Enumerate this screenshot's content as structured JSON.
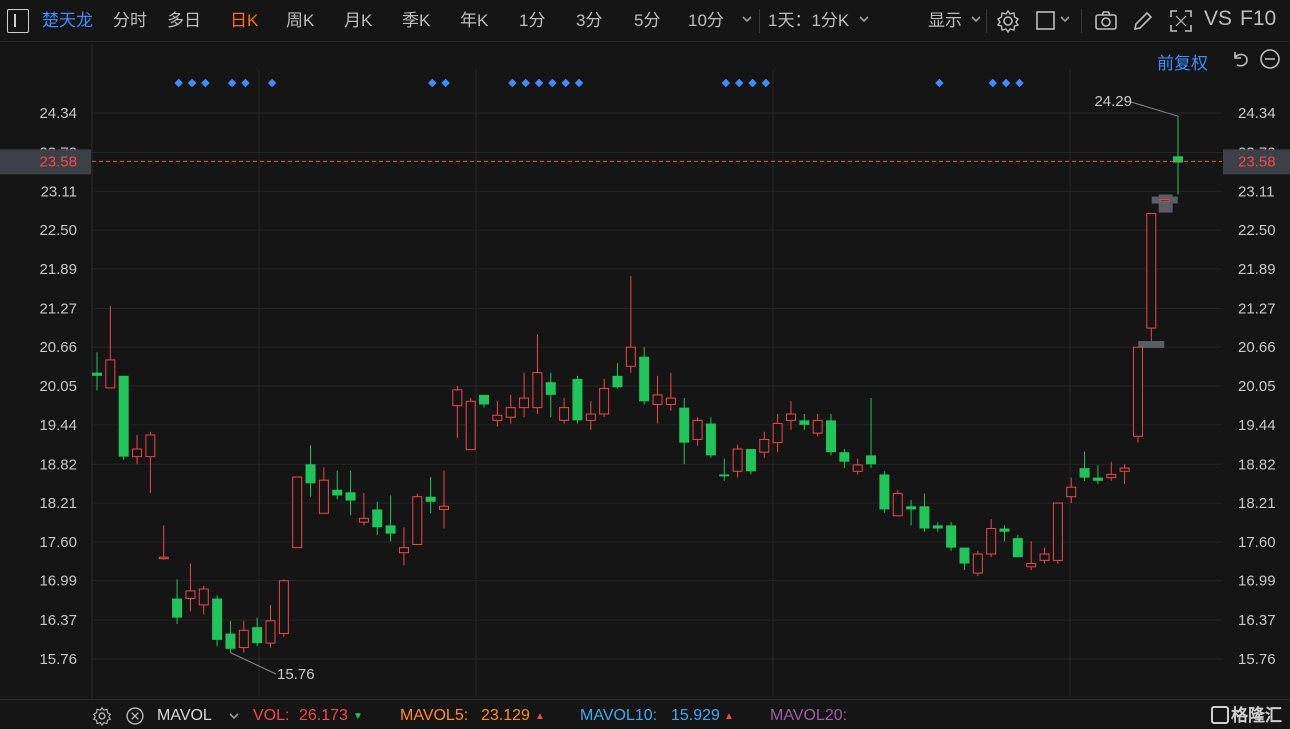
{
  "toolbar": {
    "stock_name": "楚天龙",
    "tabs": [
      "分时",
      "多日",
      "日K",
      "周K",
      "月K",
      "季K",
      "年K",
      "1分",
      "3分",
      "5分",
      "10分"
    ],
    "active_tab": "日K",
    "period_select": "1天：1分K",
    "display_select": "显示",
    "vs_label": "VS",
    "f10_label": "F10"
  },
  "chart_header": {
    "adjust_label": "前复权"
  },
  "chart_data": {
    "type": "candlestick",
    "y_ticks": [
      "24.34",
      "23.72",
      "23.11",
      "22.50",
      "21.89",
      "21.27",
      "20.66",
      "20.05",
      "19.44",
      "18.82",
      "18.21",
      "17.60",
      "16.99",
      "16.37",
      "15.76"
    ],
    "ylim": [
      15.76,
      24.34
    ],
    "current_price": "23.58",
    "max_label": "24.29",
    "min_label": "15.76",
    "up_color": "#f04848",
    "down_color": "#22c35a",
    "candles": [
      {
        "o": 20.26,
        "h": 20.58,
        "l": 19.98,
        "c": 20.21
      },
      {
        "o": 20.02,
        "h": 21.31,
        "l": 20.02,
        "c": 20.46
      },
      {
        "o": 20.21,
        "h": 20.21,
        "l": 18.89,
        "c": 18.94
      },
      {
        "o": 18.94,
        "h": 19.28,
        "l": 18.82,
        "c": 19.06
      },
      {
        "o": 18.94,
        "h": 19.33,
        "l": 18.37,
        "c": 19.28
      },
      {
        "o": 17.36,
        "h": 17.86,
        "l": 17.32,
        "c": 17.36
      },
      {
        "o": 16.71,
        "h": 17.01,
        "l": 16.31,
        "c": 16.41
      },
      {
        "o": 16.71,
        "h": 17.26,
        "l": 16.51,
        "c": 16.83
      },
      {
        "o": 16.61,
        "h": 16.91,
        "l": 16.46,
        "c": 16.86
      },
      {
        "o": 16.71,
        "h": 16.76,
        "l": 15.96,
        "c": 16.06
      },
      {
        "o": 16.16,
        "h": 16.36,
        "l": 15.86,
        "c": 15.92
      },
      {
        "o": 15.94,
        "h": 16.36,
        "l": 15.86,
        "c": 16.21
      },
      {
        "o": 16.26,
        "h": 16.41,
        "l": 15.96,
        "c": 16.01
      },
      {
        "o": 16.01,
        "h": 16.61,
        "l": 15.94,
        "c": 16.36
      },
      {
        "o": 16.16,
        "h": 17.01,
        "l": 16.11,
        "c": 16.99
      },
      {
        "o": 17.51,
        "h": 18.62,
        "l": 17.51,
        "c": 18.62
      },
      {
        "o": 18.82,
        "h": 19.12,
        "l": 18.31,
        "c": 18.52
      },
      {
        "o": 18.05,
        "h": 18.77,
        "l": 18.05,
        "c": 18.57
      },
      {
        "o": 18.42,
        "h": 18.72,
        "l": 18.27,
        "c": 18.33
      },
      {
        "o": 18.38,
        "h": 18.72,
        "l": 18.02,
        "c": 18.25
      },
      {
        "o": 17.91,
        "h": 18.37,
        "l": 17.86,
        "c": 17.97
      },
      {
        "o": 18.11,
        "h": 18.23,
        "l": 17.71,
        "c": 17.83
      },
      {
        "o": 17.86,
        "h": 18.33,
        "l": 17.61,
        "c": 17.73
      },
      {
        "o": 17.43,
        "h": 17.83,
        "l": 17.23,
        "c": 17.51
      },
      {
        "o": 17.56,
        "h": 18.36,
        "l": 17.56,
        "c": 18.31
      },
      {
        "o": 18.31,
        "h": 18.62,
        "l": 18.05,
        "c": 18.23
      },
      {
        "o": 18.11,
        "h": 18.72,
        "l": 17.81,
        "c": 18.16
      },
      {
        "o": 19.74,
        "h": 20.05,
        "l": 19.23,
        "c": 19.99
      },
      {
        "o": 19.05,
        "h": 19.86,
        "l": 19.05,
        "c": 19.81
      },
      {
        "o": 19.91,
        "h": 19.91,
        "l": 19.71,
        "c": 19.76
      },
      {
        "o": 19.51,
        "h": 19.81,
        "l": 19.41,
        "c": 19.59
      },
      {
        "o": 19.56,
        "h": 19.91,
        "l": 19.46,
        "c": 19.71
      },
      {
        "o": 19.71,
        "h": 20.26,
        "l": 19.56,
        "c": 19.86
      },
      {
        "o": 19.71,
        "h": 20.86,
        "l": 19.61,
        "c": 20.26
      },
      {
        "o": 20.11,
        "h": 20.26,
        "l": 19.56,
        "c": 19.91
      },
      {
        "o": 19.51,
        "h": 19.86,
        "l": 19.46,
        "c": 19.71
      },
      {
        "o": 20.16,
        "h": 20.21,
        "l": 19.46,
        "c": 19.51
      },
      {
        "o": 19.51,
        "h": 19.81,
        "l": 19.36,
        "c": 19.61
      },
      {
        "o": 19.61,
        "h": 20.16,
        "l": 19.56,
        "c": 20.01
      },
      {
        "o": 20.21,
        "h": 20.41,
        "l": 20.01,
        "c": 20.03
      },
      {
        "o": 20.36,
        "h": 21.78,
        "l": 20.26,
        "c": 20.66
      },
      {
        "o": 20.51,
        "h": 20.66,
        "l": 19.76,
        "c": 19.81
      },
      {
        "o": 19.76,
        "h": 20.21,
        "l": 19.46,
        "c": 19.91
      },
      {
        "o": 19.76,
        "h": 20.26,
        "l": 19.66,
        "c": 19.86
      },
      {
        "o": 19.71,
        "h": 19.86,
        "l": 18.82,
        "c": 19.16
      },
      {
        "o": 19.21,
        "h": 19.56,
        "l": 19.11,
        "c": 19.51
      },
      {
        "o": 19.46,
        "h": 19.56,
        "l": 18.92,
        "c": 18.96
      },
      {
        "o": 18.66,
        "h": 18.91,
        "l": 18.56,
        "c": 18.63
      },
      {
        "o": 18.71,
        "h": 19.13,
        "l": 18.61,
        "c": 19.06
      },
      {
        "o": 19.06,
        "h": 19.06,
        "l": 18.66,
        "c": 18.71
      },
      {
        "o": 19.01,
        "h": 19.33,
        "l": 18.92,
        "c": 19.21
      },
      {
        "o": 19.16,
        "h": 19.61,
        "l": 19.01,
        "c": 19.46
      },
      {
        "o": 19.51,
        "h": 19.81,
        "l": 19.36,
        "c": 19.61
      },
      {
        "o": 19.51,
        "h": 19.61,
        "l": 19.36,
        "c": 19.44
      },
      {
        "o": 19.31,
        "h": 19.61,
        "l": 19.26,
        "c": 19.51
      },
      {
        "o": 19.51,
        "h": 19.61,
        "l": 18.96,
        "c": 19.01
      },
      {
        "o": 19.01,
        "h": 19.06,
        "l": 18.76,
        "c": 18.86
      },
      {
        "o": 18.71,
        "h": 18.91,
        "l": 18.66,
        "c": 18.81
      },
      {
        "o": 18.96,
        "h": 19.86,
        "l": 18.76,
        "c": 18.82
      },
      {
        "o": 18.66,
        "h": 18.71,
        "l": 18.06,
        "c": 18.11
      },
      {
        "o": 18.01,
        "h": 18.41,
        "l": 18.01,
        "c": 18.36
      },
      {
        "o": 18.16,
        "h": 18.26,
        "l": 17.86,
        "c": 18.11
      },
      {
        "o": 18.16,
        "h": 18.36,
        "l": 17.76,
        "c": 17.81
      },
      {
        "o": 17.86,
        "h": 17.91,
        "l": 17.76,
        "c": 17.81
      },
      {
        "o": 17.86,
        "h": 17.91,
        "l": 17.46,
        "c": 17.51
      },
      {
        "o": 17.51,
        "h": 17.51,
        "l": 17.16,
        "c": 17.26
      },
      {
        "o": 17.11,
        "h": 17.46,
        "l": 17.06,
        "c": 17.41
      },
      {
        "o": 17.41,
        "h": 17.96,
        "l": 17.36,
        "c": 17.81
      },
      {
        "o": 17.81,
        "h": 17.86,
        "l": 17.61,
        "c": 17.76
      },
      {
        "o": 17.66,
        "h": 17.71,
        "l": 17.36,
        "c": 17.36
      },
      {
        "o": 17.21,
        "h": 17.61,
        "l": 17.16,
        "c": 17.26
      },
      {
        "o": 17.31,
        "h": 17.51,
        "l": 17.26,
        "c": 17.41
      },
      {
        "o": 17.31,
        "h": 18.21,
        "l": 17.26,
        "c": 18.21
      },
      {
        "o": 18.31,
        "h": 18.61,
        "l": 18.21,
        "c": 18.46
      },
      {
        "o": 18.76,
        "h": 19.02,
        "l": 18.56,
        "c": 18.61
      },
      {
        "o": 18.61,
        "h": 18.81,
        "l": 18.51,
        "c": 18.56
      },
      {
        "o": 18.61,
        "h": 18.86,
        "l": 18.56,
        "c": 18.66
      },
      {
        "o": 18.71,
        "h": 18.82,
        "l": 18.51,
        "c": 18.76
      },
      {
        "o": 19.26,
        "h": 20.66,
        "l": 19.16,
        "c": 20.66
      },
      {
        "o": 20.96,
        "h": 22.76,
        "l": 20.76,
        "c": 22.76
      },
      {
        "o": 22.98,
        "h": 22.98,
        "l": 22.98,
        "c": 22.98
      },
      {
        "o": 23.66,
        "h": 24.29,
        "l": 23.06,
        "c": 23.56
      }
    ],
    "event_dot_indices": [
      2,
      3,
      4,
      6,
      7,
      9,
      21,
      22,
      27,
      28,
      29,
      30,
      31,
      32,
      43,
      44,
      45,
      46,
      59,
      63,
      64,
      65
    ],
    "ghost_marks": [
      {
        "index": 79,
        "price": 20.71
      },
      {
        "index": 80,
        "price": 22.98
      }
    ]
  },
  "bottom_bar": {
    "indicator": "MAVOL",
    "vol_label": "VOL:",
    "vol_value": "26.173",
    "mavol5_label": "MAVOL5:",
    "mavol5_value": "23.129",
    "mavol10_label": "MAVOL10:",
    "mavol10_value": "15.929",
    "mavol20_label": "MAVOL20:",
    "watermark": "格隆汇"
  },
  "colors": {
    "up": "#f04848",
    "down": "#22c35a",
    "accent": "#3f8cff",
    "active_tab": "#ff6a1f",
    "current_line": "#e0612a",
    "mavol5": "#ff8a2a",
    "mavol10": "#3fa9f5",
    "mavol20": "#a05aa8"
  }
}
